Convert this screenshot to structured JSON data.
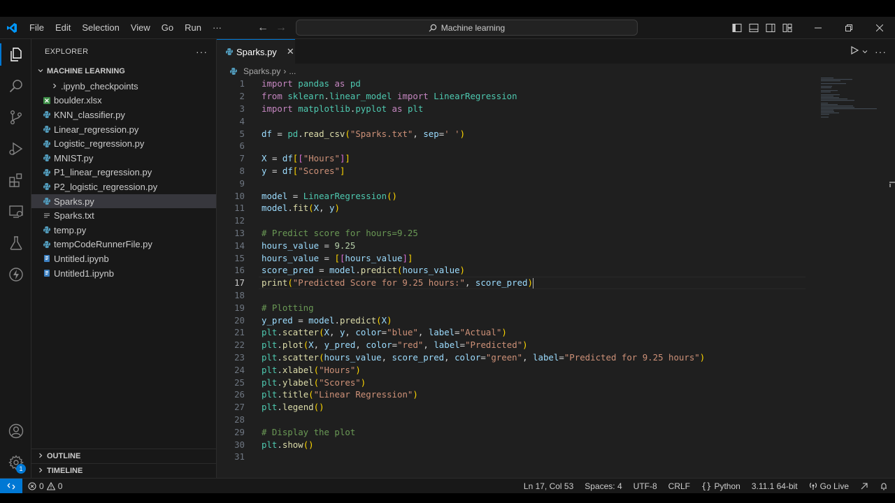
{
  "menu": [
    "File",
    "Edit",
    "Selection",
    "View",
    "Go",
    "Run",
    "···"
  ],
  "command_center": {
    "text": "Machine learning"
  },
  "explorer": {
    "title": "EXPLORER",
    "more": "···",
    "folder": "MACHINE LEARNING",
    "items": [
      {
        "label": ".ipynb_checkpoints",
        "type": "folder"
      },
      {
        "label": "boulder.xlsx",
        "type": "excel"
      },
      {
        "label": "KNN_classifier.py",
        "type": "python"
      },
      {
        "label": "Linear_regression.py",
        "type": "python"
      },
      {
        "label": "Logistic_regression.py",
        "type": "python"
      },
      {
        "label": "MNIST.py",
        "type": "python"
      },
      {
        "label": "P1_linear_regression.py",
        "type": "python"
      },
      {
        "label": "P2_logistic_regression.py",
        "type": "python"
      },
      {
        "label": "Sparks.py",
        "type": "python",
        "selected": true
      },
      {
        "label": "Sparks.txt",
        "type": "text"
      },
      {
        "label": "temp.py",
        "type": "python"
      },
      {
        "label": "tempCodeRunnerFile.py",
        "type": "python"
      },
      {
        "label": "Untitled.ipynb",
        "type": "notebook"
      },
      {
        "label": "Untitled1.ipynb",
        "type": "notebook"
      }
    ],
    "outline": "OUTLINE",
    "timeline": "TIMELINE"
  },
  "tab": {
    "label": "Sparks.py",
    "close": "✕"
  },
  "breadcrumb": {
    "file": "Sparks.py",
    "sep": "›",
    "rest": "..."
  },
  "code_lines": [
    "import pandas as pd",
    "from sklearn.linear_model import LinearRegression",
    "import matplotlib.pyplot as plt",
    "",
    "df = pd.read_csv(\"Sparks.txt\", sep=' ')",
    "",
    "X = df[[\"Hours\"]]",
    "y = df[\"Scores\"]",
    "",
    "model = LinearRegression()",
    "model.fit(X, y)",
    "",
    "# Predict score for hours=9.25",
    "hours_value = 9.25",
    "hours_value = [[hours_value]]",
    "score_pred = model.predict(hours_value)",
    "print(\"Predicted Score for 9.25 hours:\", score_pred)",
    "",
    "# Plotting",
    "y_pred = model.predict(X)",
    "plt.scatter(X, y, color=\"blue\", label=\"Actual\")",
    "plt.plot(X, y_pred, color=\"red\", label=\"Predicted\")",
    "plt.scatter(hours_value, score_pred, color=\"green\", label=\"Predicted for 9.25 hours\")",
    "plt.xlabel(\"Hours\")",
    "plt.ylabel(\"Scores\")",
    "plt.title(\"Linear Regression\")",
    "plt.legend()",
    "",
    "# Display the plot",
    "plt.show()",
    ""
  ],
  "current_line": 17,
  "status": {
    "errors": "0",
    "warnings": "0",
    "position": "Ln 17, Col 53",
    "spaces": "Spaces: 4",
    "encoding": "UTF-8",
    "eol": "CRLF",
    "language": "Python",
    "interpreter": "3.11.1 64-bit",
    "golive": "Go Live"
  },
  "accounts_badge": "1",
  "colors": {
    "accent": "#0078d4",
    "editor_bg": "#1f1f1f",
    "sidebar_bg": "#181818"
  }
}
